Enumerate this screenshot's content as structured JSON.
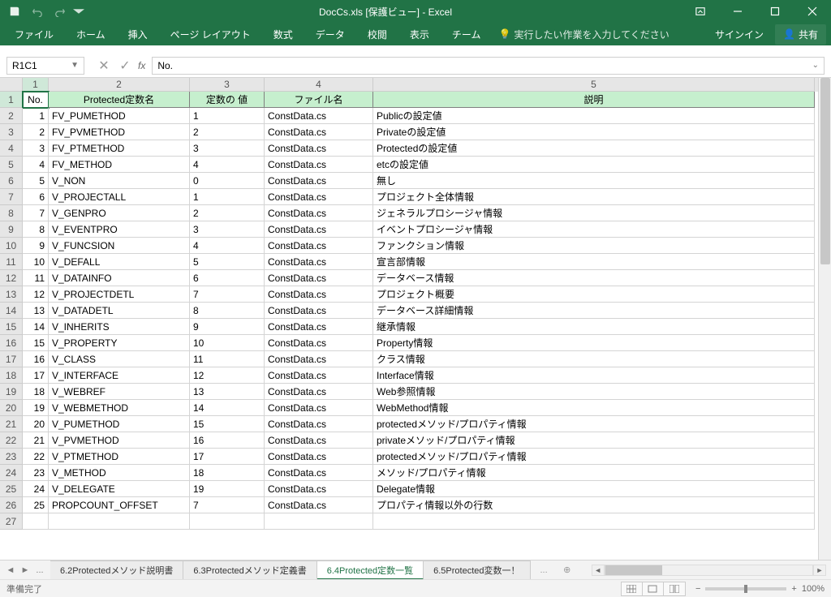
{
  "titlebar": {
    "title": "DocCs.xls  [保護ビュー] - Excel"
  },
  "ribbon": {
    "tabs": [
      "ファイル",
      "ホーム",
      "挿入",
      "ページ レイアウト",
      "数式",
      "データ",
      "校閲",
      "表示",
      "チーム"
    ],
    "tellme": "実行したい作業を入力してください",
    "signin": "サインイン",
    "share": "共有"
  },
  "formula": {
    "namebox": "R1C1",
    "value": "No."
  },
  "columns": [
    "1",
    "2",
    "3",
    "4",
    "5"
  ],
  "header_row": [
    "No.",
    "Protected定数名",
    "定数の 値",
    "ファイル名",
    "説明"
  ],
  "rows": [
    {
      "n": "1",
      "name": "FV_PUMETHOD",
      "val": "1",
      "file": "ConstData.cs",
      "desc": "Publicの設定値"
    },
    {
      "n": "2",
      "name": "FV_PVMETHOD",
      "val": "2",
      "file": "ConstData.cs",
      "desc": "Privateの設定値"
    },
    {
      "n": "3",
      "name": "FV_PTMETHOD",
      "val": "3",
      "file": "ConstData.cs",
      "desc": "Protectedの設定値"
    },
    {
      "n": "4",
      "name": "FV_METHOD",
      "val": "4",
      "file": "ConstData.cs",
      "desc": "etcの設定値"
    },
    {
      "n": "5",
      "name": "V_NON",
      "val": "0",
      "file": "ConstData.cs",
      "desc": "無し"
    },
    {
      "n": "6",
      "name": "V_PROJECTALL",
      "val": "1",
      "file": "ConstData.cs",
      "desc": "プロジェクト全体情報"
    },
    {
      "n": "7",
      "name": "V_GENPRO",
      "val": "2",
      "file": "ConstData.cs",
      "desc": "ジェネラルプロシージャ情報"
    },
    {
      "n": "8",
      "name": "V_EVENTPRO",
      "val": "3",
      "file": "ConstData.cs",
      "desc": "イベントプロシージャ情報"
    },
    {
      "n": "9",
      "name": "V_FUNCSION",
      "val": "4",
      "file": "ConstData.cs",
      "desc": "ファンクション情報"
    },
    {
      "n": "10",
      "name": "V_DEFALL",
      "val": "5",
      "file": "ConstData.cs",
      "desc": "宣言部情報"
    },
    {
      "n": "11",
      "name": "V_DATAINFO",
      "val": "6",
      "file": "ConstData.cs",
      "desc": "データベース情報"
    },
    {
      "n": "12",
      "name": "V_PROJECTDETL",
      "val": "7",
      "file": "ConstData.cs",
      "desc": "プロジェクト概要"
    },
    {
      "n": "13",
      "name": "V_DATADETL",
      "val": "8",
      "file": "ConstData.cs",
      "desc": "データベース詳細情報"
    },
    {
      "n": "14",
      "name": "V_INHERITS",
      "val": "9",
      "file": "ConstData.cs",
      "desc": "継承情報"
    },
    {
      "n": "15",
      "name": "V_PROPERTY",
      "val": "10",
      "file": "ConstData.cs",
      "desc": "Property情報"
    },
    {
      "n": "16",
      "name": "V_CLASS",
      "val": "11",
      "file": "ConstData.cs",
      "desc": "クラス情報"
    },
    {
      "n": "17",
      "name": "V_INTERFACE",
      "val": "12",
      "file": "ConstData.cs",
      "desc": "Interface情報"
    },
    {
      "n": "18",
      "name": "V_WEBREF",
      "val": "13",
      "file": "ConstData.cs",
      "desc": "Web参照情報"
    },
    {
      "n": "19",
      "name": "V_WEBMETHOD",
      "val": "14",
      "file": "ConstData.cs",
      "desc": "WebMethod情報"
    },
    {
      "n": "20",
      "name": "V_PUMETHOD",
      "val": "15",
      "file": "ConstData.cs",
      "desc": "protectedメソッド/プロパティ情報"
    },
    {
      "n": "21",
      "name": "V_PVMETHOD",
      "val": "16",
      "file": "ConstData.cs",
      "desc": "privateメソッド/プロパティ情報"
    },
    {
      "n": "22",
      "name": "V_PTMETHOD",
      "val": "17",
      "file": "ConstData.cs",
      "desc": "protectedメソッド/プロパティ情報"
    },
    {
      "n": "23",
      "name": "V_METHOD",
      "val": "18",
      "file": "ConstData.cs",
      "desc": "メソッド/プロパティ情報"
    },
    {
      "n": "24",
      "name": "V_DELEGATE",
      "val": "19",
      "file": "ConstData.cs",
      "desc": "Delegate情報"
    },
    {
      "n": "25",
      "name": "PROPCOUNT_OFFSET",
      "val": "7",
      "file": "ConstData.cs",
      "desc": "プロパティ情報以外の行数"
    }
  ],
  "tabs": {
    "ellipsis": "...",
    "items": [
      {
        "label": "6.2Protectedメソッド説明書",
        "active": false
      },
      {
        "label": "6.3Protectedメソッド定義書",
        "active": false
      },
      {
        "label": "6.4Protected定数一覧",
        "active": true
      },
      {
        "label": "6.5Protected変数一！",
        "active": false
      }
    ],
    "more": "..."
  },
  "status": {
    "ready": "準備完了",
    "zoom": "100%"
  }
}
